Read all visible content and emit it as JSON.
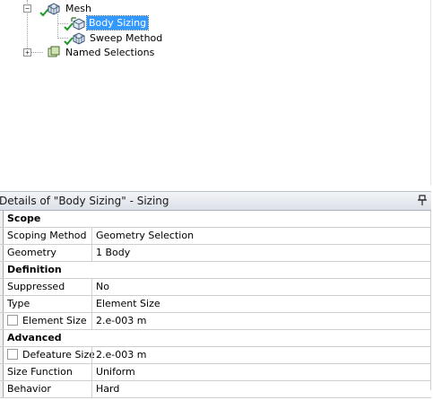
{
  "tree": {
    "mesh": {
      "label": "Mesh",
      "expander": "−"
    },
    "body_sizing": {
      "label": "Body Sizing"
    },
    "sweep_method": {
      "label": "Sweep Method"
    },
    "named_selections": {
      "label": "Named Selections",
      "expander": "+"
    }
  },
  "details": {
    "title": "Details of \"Body Sizing\" - Sizing",
    "rows": [
      {
        "kind": "section",
        "label": "Scope"
      },
      {
        "kind": "prop",
        "label": "Scoping Method",
        "value": "Geometry Selection"
      },
      {
        "kind": "prop",
        "label": "Geometry",
        "value": "1 Body"
      },
      {
        "kind": "section",
        "label": "Definition"
      },
      {
        "kind": "prop",
        "label": "Suppressed",
        "value": "No"
      },
      {
        "kind": "prop",
        "label": "Type",
        "value": "Element Size"
      },
      {
        "kind": "prop",
        "label": "Element Size",
        "value": "2.e-003 m",
        "checkbox": true
      },
      {
        "kind": "section",
        "label": "Advanced"
      },
      {
        "kind": "prop",
        "label": "Defeature Size",
        "value": "2.e-003 m",
        "checkbox": true
      },
      {
        "kind": "prop",
        "label": "Size Function",
        "value": "Uniform"
      },
      {
        "kind": "prop",
        "label": "Behavior",
        "value": "Hard"
      }
    ]
  },
  "colors": {
    "selection": "#3399ff",
    "check": "#1e9a2e",
    "header_gradient_top": "#f3f5f8",
    "header_gradient_bottom": "#dbe1e8"
  },
  "icons": {
    "mesh": "mesh-icon",
    "sizing": "sizing-icon",
    "method": "sweep-method-icon",
    "named_selections": "named-selections-icon",
    "status": "check-icon",
    "pin": "pin-icon"
  }
}
